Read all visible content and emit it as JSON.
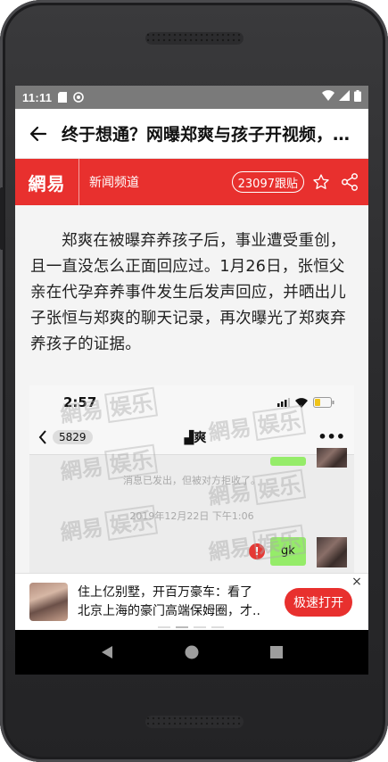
{
  "status_bar": {
    "time": "11:11"
  },
  "app_bar": {
    "title": "终于想通？网曝郑爽与孩子开视频，疑似重新接受孩子"
  },
  "header": {
    "logo": "網易",
    "channel": "新闻频道",
    "follow_count": "23097跟贴"
  },
  "article": {
    "paragraph": "郑爽在被曝弃养孩子后，事业遭受重创，且一直没怎么正面回应过。1月26日，张恒父亲在代孕弃养事件发生后发声回应，并晒出儿子张恒与郑爽的聊天记录，再次曝光了郑爽弃养孩子的证据。"
  },
  "embedded_image": {
    "time": "2:57",
    "back_count": "5829",
    "contact_name": "▟爽",
    "more": "•••",
    "system_msg": "消息已发出，但被对方拒收了。",
    "date_msg": "2019年12月22日 下午1:06",
    "error_mark": "!",
    "reply_text": "gk",
    "watermark_a": "網易",
    "watermark_b": "娱乐"
  },
  "ad": {
    "line1": "住上亿别墅，开百万豪车：看了",
    "line2": "北京上海的豪门高端保姆圈，才..",
    "button": "极速打开",
    "close": "×"
  },
  "colors": {
    "brand_red": "#e8302e",
    "status_bar": "#7a7a7a",
    "wechat_green": "#95ec69"
  },
  "icons": {
    "back": "arrow-left-icon",
    "star": "star-icon",
    "share": "share-icon",
    "nav_back": "triangle-back-icon",
    "nav_home": "circle-home-icon",
    "nav_recents": "square-recents-icon"
  }
}
